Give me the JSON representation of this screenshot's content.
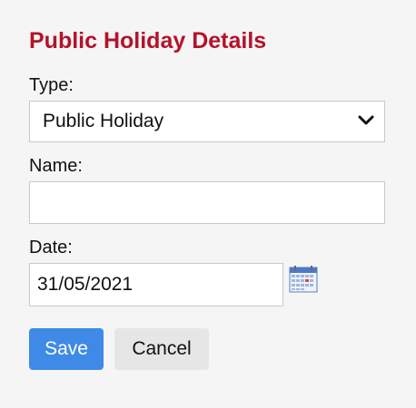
{
  "form": {
    "title": "Public Holiday Details",
    "type_label": "Type:",
    "type_value": "Public Holiday",
    "name_label": "Name:",
    "name_value": "",
    "date_label": "Date:",
    "date_value": "31/05/2021",
    "save_label": "Save",
    "cancel_label": "Cancel"
  },
  "icons": {
    "type_dropdown": "chevron-down-icon",
    "date_picker": "calendar-icon"
  },
  "colors": {
    "title": "#b5122a",
    "primary_button": "#3f8ae6",
    "secondary_button": "#e6e6e6",
    "background": "#f5f5f5"
  }
}
